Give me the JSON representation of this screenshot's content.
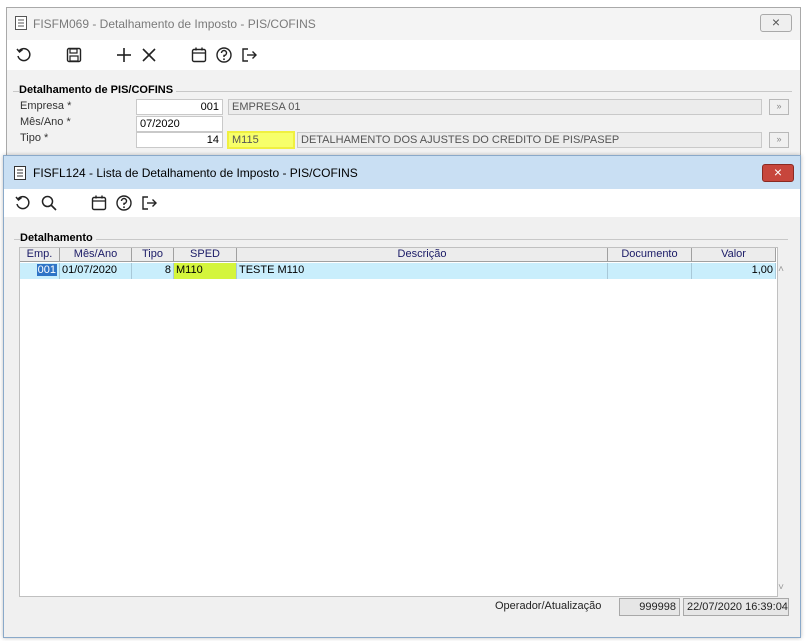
{
  "main_window": {
    "title": "FISFM069 - Detalhamento de Imposto - PIS/COFINS",
    "close_symbol": "×",
    "toolbar": {
      "icons": [
        "undo-icon",
        "save-icon",
        "add-icon",
        "delete-icon",
        "calendar-icon",
        "help-icon",
        "exit-icon"
      ]
    },
    "group_title": "Detalhamento de PIS/COFINS",
    "fields": {
      "empresa_label": "Empresa *",
      "empresa_code": "001",
      "empresa_name": "EMPRESA 01",
      "mes_ano_label": "Mês/Ano *",
      "mes_ano_value": "07/2020",
      "tipo_label": "Tipo *",
      "tipo_code": "14",
      "tipo_sped": "M115",
      "tipo_desc": "DETALHAMENTO DOS AJUSTES DO CREDITO DE PIS/PASEP"
    }
  },
  "list_window": {
    "title": "FISFL124 - Lista de Detalhamento de Imposto - PIS/COFINS",
    "close_symbol": "×",
    "toolbar": {
      "icons": [
        "refresh-icon",
        "search-icon",
        "calendar-icon",
        "help-icon",
        "exit-icon"
      ]
    },
    "group_title": "Detalhamento",
    "columns": [
      "Emp.",
      "Mês/Ano",
      "Tipo",
      "SPED",
      "Descrição",
      "Documento",
      "Valor"
    ],
    "rows": [
      {
        "emp": "001",
        "mes_ano": "01/07/2020",
        "tipo": "8",
        "sped": "M110",
        "descricao": "TESTE M110",
        "documento": "",
        "valor": "1,00"
      }
    ],
    "footer": {
      "label": "Operador/Atualização",
      "operador": "999998",
      "atualizacao": "22/07/2020 16:39:04"
    }
  },
  "colors": {
    "selected_row": "#c9eefc",
    "sped_highlight": "#d4f53c",
    "field_highlight": "#f7ff6a",
    "title_active": "#c9dff3",
    "close_red": "#c7463c"
  }
}
